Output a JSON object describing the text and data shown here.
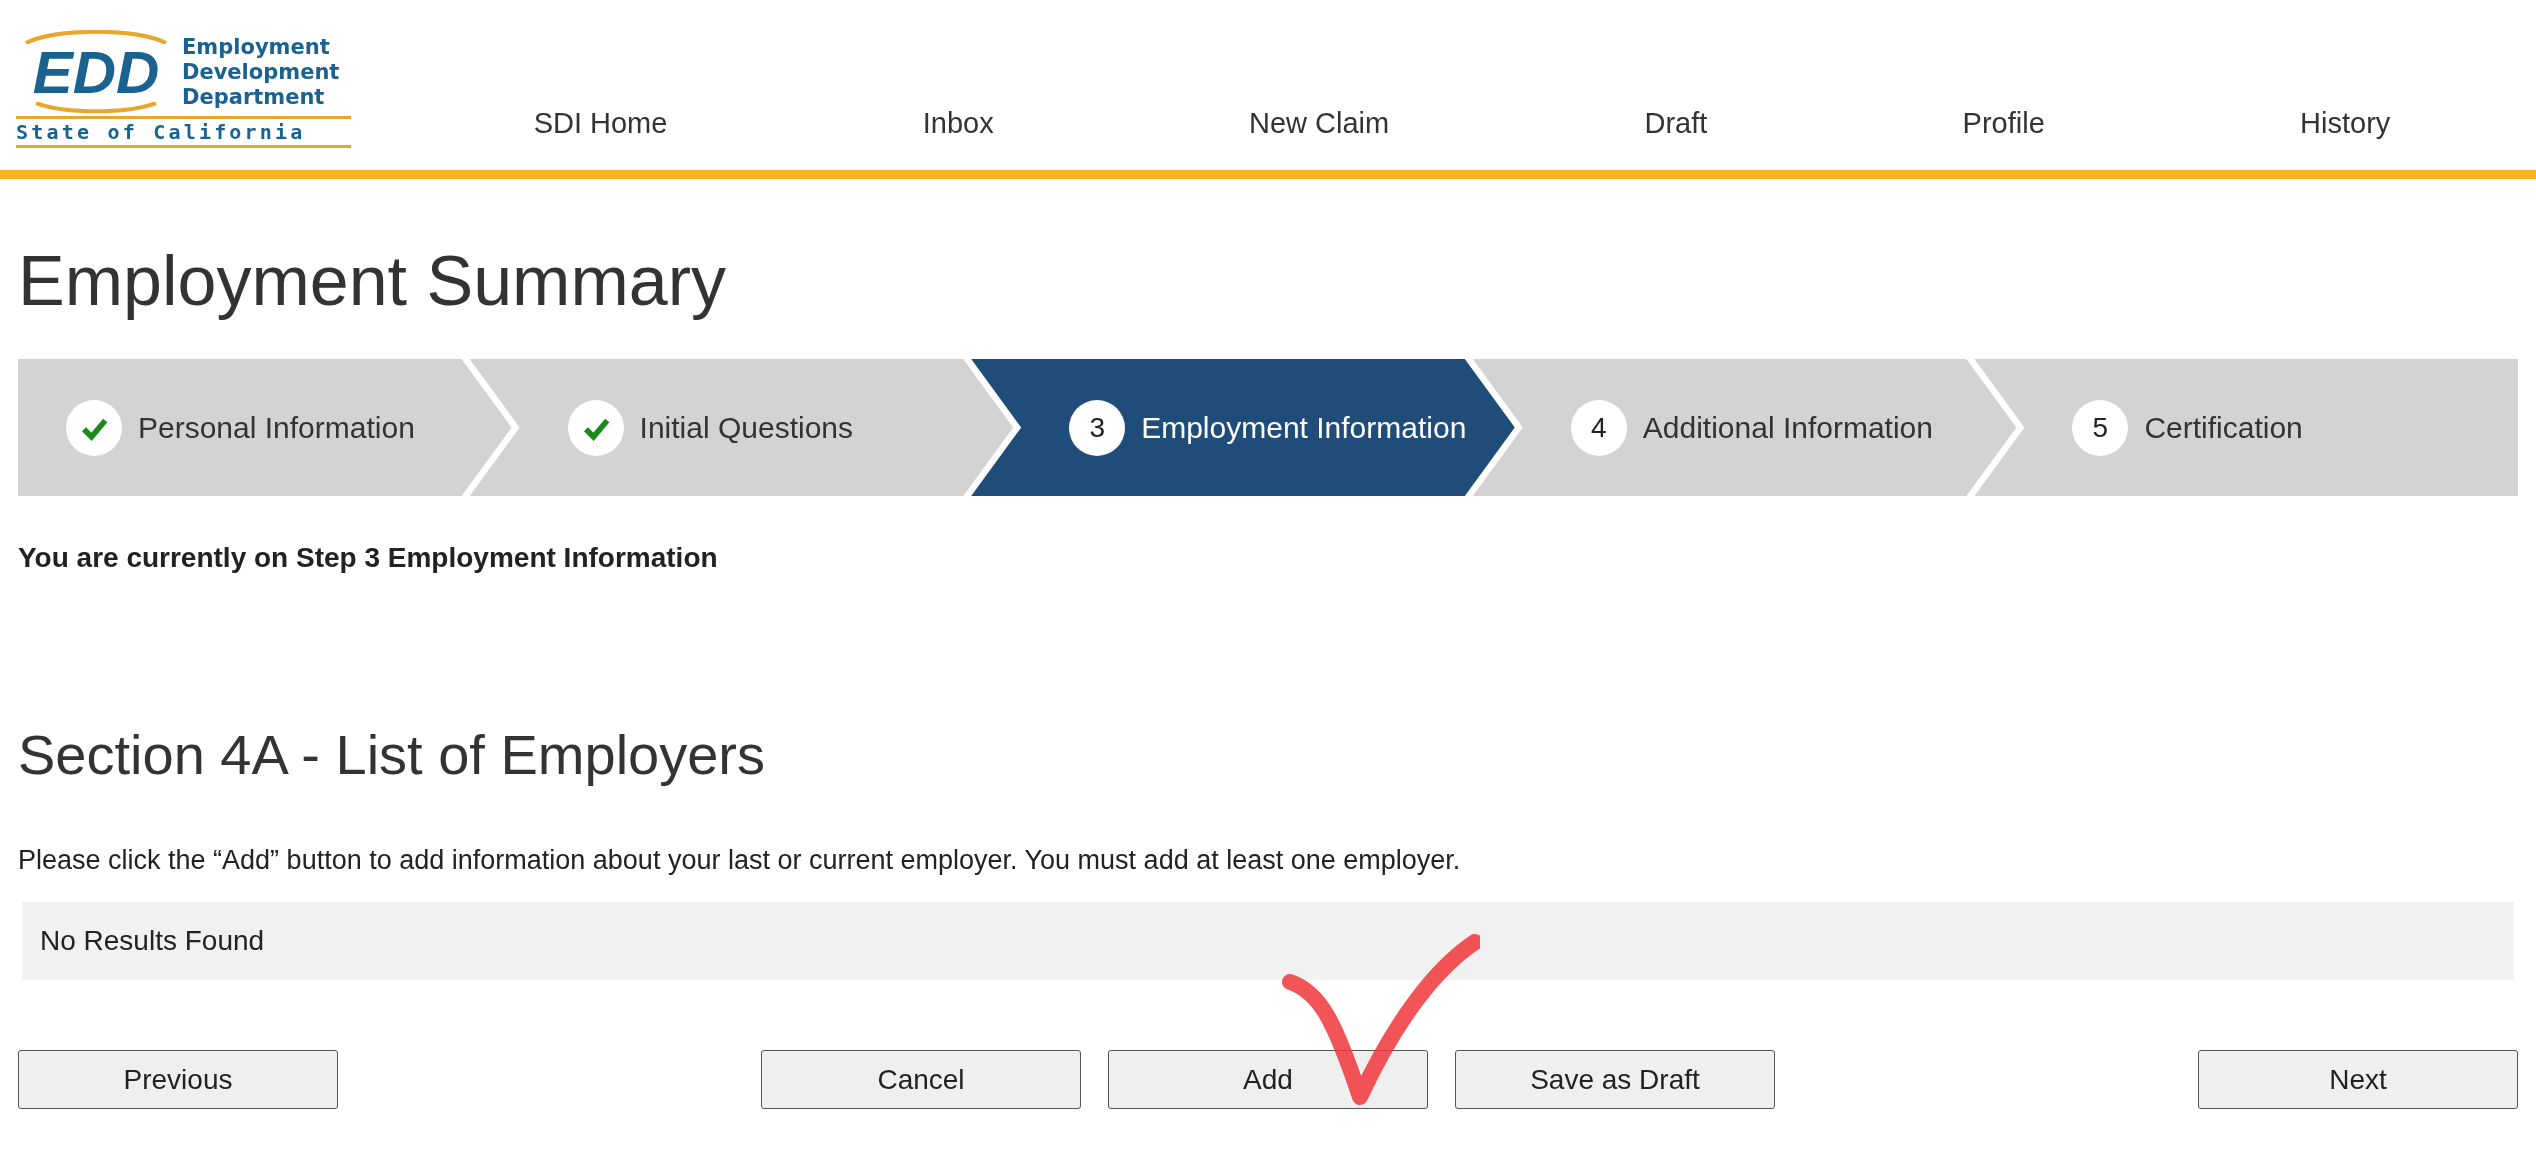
{
  "logo": {
    "initials": "EDD",
    "lines": [
      "Employment",
      "Development",
      "Department"
    ],
    "state": "State of California"
  },
  "nav": [
    "SDI Home",
    "Inbox",
    "New Claim",
    "Draft",
    "Profile",
    "History"
  ],
  "title": "Employment Summary",
  "steps": [
    {
      "label": "Personal Information",
      "completed": true,
      "selected": false
    },
    {
      "label": "Initial Questions",
      "completed": true,
      "selected": false
    },
    {
      "number": "3",
      "label": "Employment Information",
      "completed": false,
      "selected": true
    },
    {
      "number": "4",
      "label": "Additional Information",
      "completed": false,
      "selected": false
    },
    {
      "number": "5",
      "label": "Certification",
      "completed": false,
      "selected": false
    }
  ],
  "step_status": "You are currently on Step 3 Employment Information",
  "section": {
    "heading": "Section 4A - List of Employers",
    "instructions": "Please click the “Add” button to add information about your last or current employer. You must add at least one employer.",
    "results": "No Results Found"
  },
  "buttons": {
    "left": [
      "Previous"
    ],
    "center": [
      "Cancel",
      "Add",
      "Save as Draft"
    ],
    "right": [
      "Next"
    ]
  }
}
